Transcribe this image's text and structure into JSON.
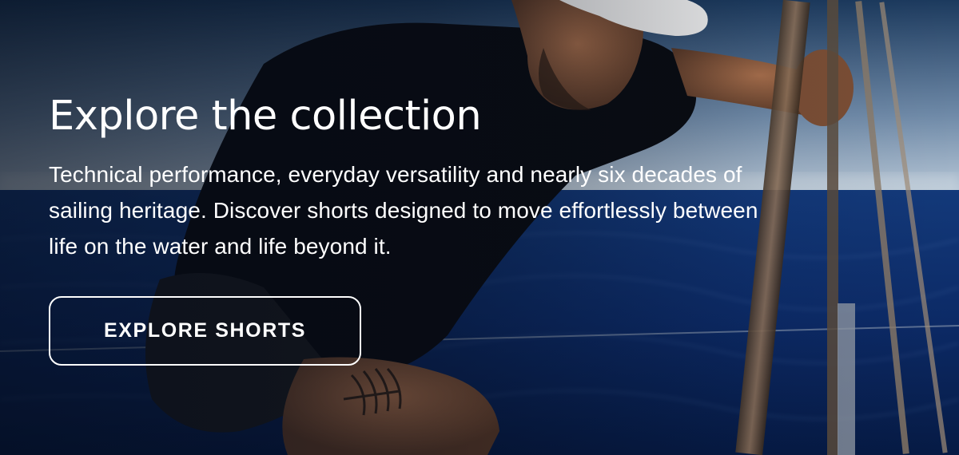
{
  "hero": {
    "title": "Explore the collection",
    "description": "Technical performance, everyday versatility and nearly six decades of sailing heritage. Discover shorts designed to move effortlessly between life on the water and life beyond it.",
    "cta_label": "EXPLORE SHORTS",
    "image_subject": "sailor-on-boat-photo"
  },
  "colors": {
    "text": "#ffffff",
    "sky_top": "#1f3f63",
    "sky_horizon": "#9fb3c9",
    "sea": "#0c2a66",
    "sea_deep": "#06183f",
    "skin": "#8a5a3e",
    "cap": "#f2f2f2",
    "shirt": "#0a0c12"
  }
}
